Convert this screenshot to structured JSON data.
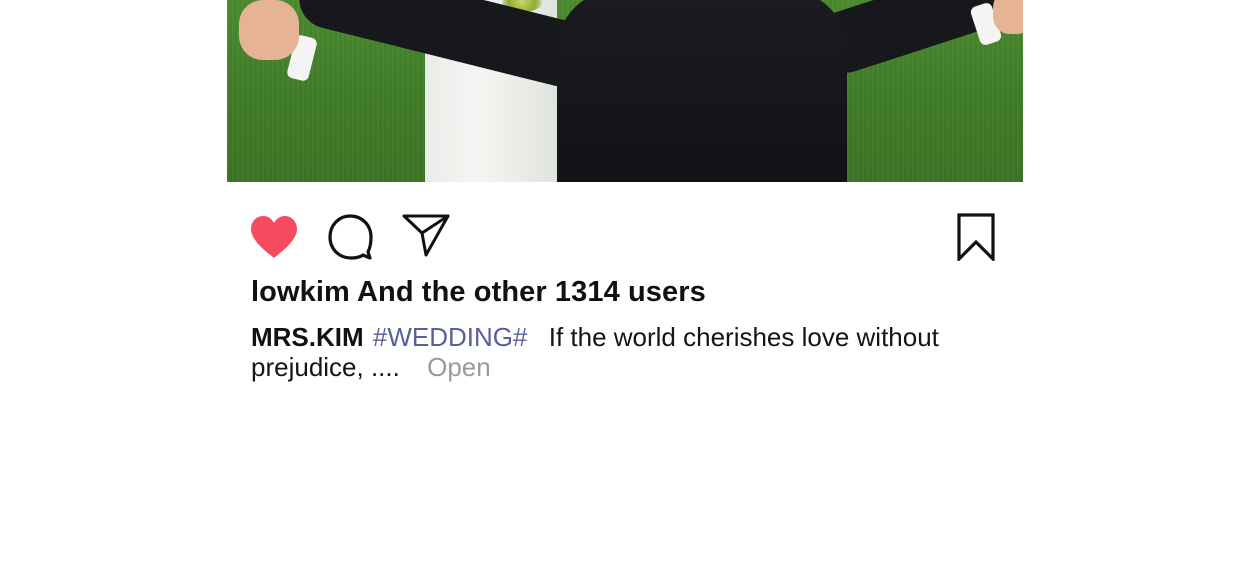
{
  "post": {
    "likes_text": "lowkim And the other 1314 users",
    "caption": {
      "author": "MRS.KIM",
      "hashtag": "#WEDDING#",
      "text_line1": "If the world cherishes love without",
      "text_line2": "prejudice, ....",
      "more_label": "Open"
    }
  },
  "icons": {
    "like": "heart-icon",
    "comment": "speech-bubble-icon",
    "share": "paper-plane-icon",
    "save": "bookmark-icon"
  },
  "colors": {
    "like_active": "#f54b5e",
    "hashtag": "#5a5f9c",
    "more_link": "#9b9b9b",
    "text": "#111111",
    "icon_stroke": "#111111"
  }
}
